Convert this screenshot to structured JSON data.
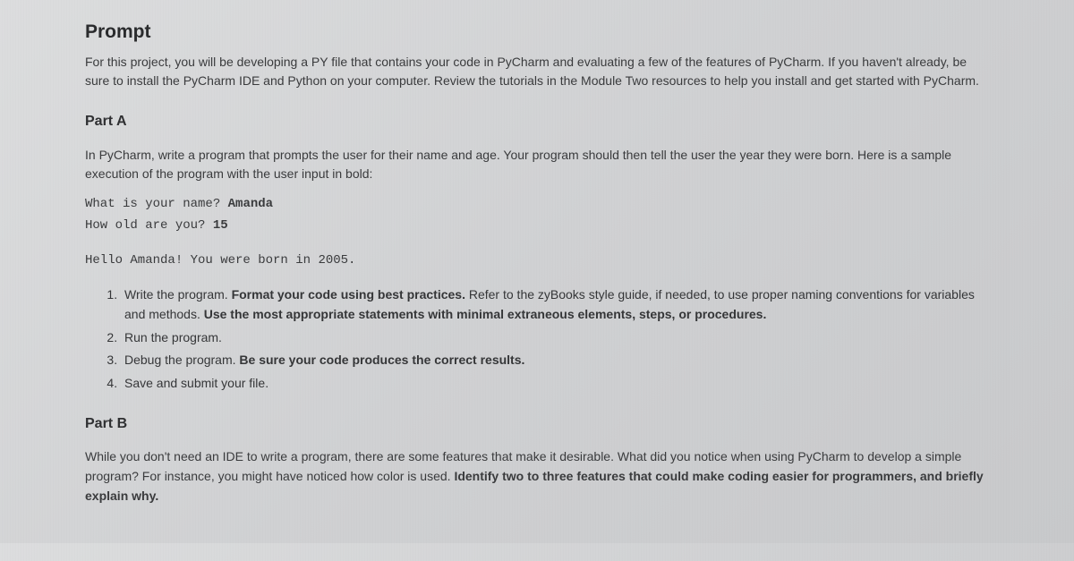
{
  "prompt": {
    "heading": "Prompt",
    "text": "For this project, you will be developing a PY file that contains your code in PyCharm and evaluating a few of the features of PyCharm. If you haven't already, be sure to install the PyCharm IDE and Python on your computer. Review the tutorials in the Module Two resources to help you install and get started with PyCharm."
  },
  "partA": {
    "heading": "Part A",
    "intro": "In PyCharm, write a program that prompts the user for their name and age. Your program should then tell the user the year they were born. Here is a sample execution of the program with the user input in bold:",
    "sample": {
      "line1_prompt": "What is your name? ",
      "line1_input": "Amanda",
      "line2_prompt": "How old are you? ",
      "line2_input": "15",
      "line3": "Hello Amanda! You were born in 2005."
    },
    "steps": [
      {
        "prefix": "Write the program. ",
        "bold1": "Format your code using best practices.",
        "mid": " Refer to the zyBooks style guide, if needed, to use proper naming conventions for variables and methods. ",
        "bold2": "Use the most appropriate statements with minimal extraneous elements, steps, or procedures."
      },
      {
        "prefix": "Run the program.",
        "bold1": "",
        "mid": "",
        "bold2": ""
      },
      {
        "prefix": "Debug the program. ",
        "bold1": "Be sure your code produces the correct results.",
        "mid": "",
        "bold2": ""
      },
      {
        "prefix": "Save and submit your file.",
        "bold1": "",
        "mid": "",
        "bold2": ""
      }
    ]
  },
  "partB": {
    "heading": "Part B",
    "text_prefix": "While you don't need an IDE to write a program, there are some features that make it desirable. What did you notice when using PyCharm to develop a simple program? For instance, you might have noticed how color is used. ",
    "text_bold": "Identify two to three features that could make coding easier for programmers, and briefly explain why."
  }
}
